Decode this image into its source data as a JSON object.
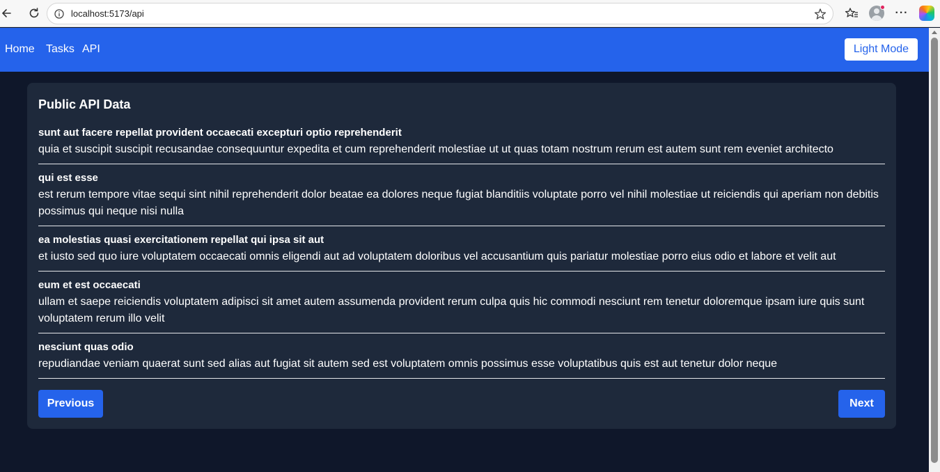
{
  "browser": {
    "url": "localhost:5173/api"
  },
  "nav": {
    "home": "Home",
    "tasks": "Tasks",
    "api": "API",
    "theme_button": "Light Mode"
  },
  "card": {
    "title": "Public API Data",
    "posts": [
      {
        "title": "sunt aut facere repellat provident occaecati excepturi optio reprehenderit",
        "body": "quia et suscipit suscipit recusandae consequuntur expedita et cum reprehenderit molestiae ut ut quas totam nostrum rerum est autem sunt rem eveniet architecto"
      },
      {
        "title": "qui est esse",
        "body": "est rerum tempore vitae sequi sint nihil reprehenderit dolor beatae ea dolores neque fugiat blanditiis voluptate porro vel nihil molestiae ut reiciendis qui aperiam non debitis possimus qui neque nisi nulla"
      },
      {
        "title": "ea molestias quasi exercitationem repellat qui ipsa sit aut",
        "body": "et iusto sed quo iure voluptatem occaecati omnis eligendi aut ad voluptatem doloribus vel accusantium quis pariatur molestiae porro eius odio et labore et velit aut"
      },
      {
        "title": "eum et est occaecati",
        "body": "ullam et saepe reiciendis voluptatem adipisci sit amet autem assumenda provident rerum culpa quis hic commodi nesciunt rem tenetur doloremque ipsam iure quis sunt voluptatem rerum illo velit"
      },
      {
        "title": "nesciunt quas odio",
        "body": "repudiandae veniam quaerat sunt sed alias aut fugiat sit autem sed est voluptatem omnis possimus esse voluptatibus quis est aut tenetur dolor neque"
      }
    ],
    "previous_label": "Previous",
    "next_label": "Next"
  },
  "colors": {
    "accent": "#2563eb",
    "page_background": "#0f172a",
    "card_background": "#1e293b"
  },
  "icons": [
    "back-arrow-icon",
    "reload-icon",
    "info-icon",
    "star-icon",
    "favorites-icon",
    "profile-avatar-icon",
    "more-icon",
    "copilot-icon"
  ]
}
